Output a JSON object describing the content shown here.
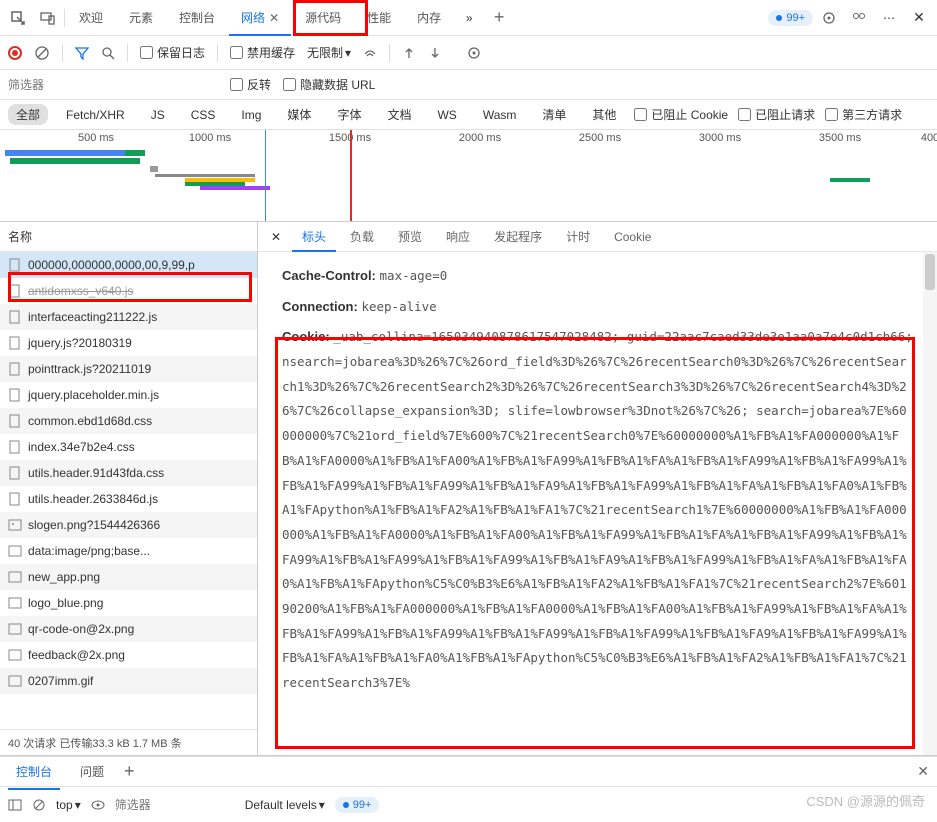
{
  "topTabs": {
    "welcome": "欢迎",
    "elements": "元素",
    "console": "控制台",
    "network": "网络",
    "sources": "源代码",
    "performance": "性能",
    "memory": "内存"
  },
  "badge99": "99+",
  "toolbar": {
    "preserve_log": "保留日志",
    "disable_cache": "禁用缓存",
    "throttling": "无限制"
  },
  "filter": {
    "placeholder": "筛选器",
    "invert": "反转",
    "hide_data_urls": "隐藏数据 URL"
  },
  "types": {
    "all": "全部",
    "fetch": "Fetch/XHR",
    "js": "JS",
    "css": "CSS",
    "img": "Img",
    "media": "媒体",
    "font": "字体",
    "doc": "文档",
    "ws": "WS",
    "wasm": "Wasm",
    "manifest": "清单",
    "other": "其他",
    "blocked_cookie": "已阻止 Cookie",
    "blocked_req": "已阻止请求",
    "third_party": "第三方请求"
  },
  "timeline": {
    "t500": "500 ms",
    "t1000": "1000 ms",
    "t1500": "1500 ms",
    "t2000": "2000 ms",
    "t2500": "2500 ms",
    "t3000": "3000 ms",
    "t3500": "3500 ms",
    "t4000": "400"
  },
  "leftHeader": "名称",
  "files": [
    "000000,000000,0000,00,9,99,p",
    "antidomxss_v640.js",
    "interfaceacting211222.js",
    "jquery.js?20180319",
    "pointtrack.js?20211019",
    "jquery.placeholder.min.js",
    "common.ebd1d68d.css",
    "index.34e7b2e4.css",
    "utils.header.91d43fda.css",
    "utils.header.2633846d.js",
    "slogen.png?1544426366",
    "data:image/png;base...",
    "new_app.png",
    "logo_blue.png",
    "qr-code-on@2x.png",
    "feedback@2x.png",
    "0207imm.gif"
  ],
  "statusBar": "40 次请求  已传输33.3 kB  1.7 MB 条",
  "detailTabs": {
    "headers": "标头",
    "payload": "负载",
    "preview": "预览",
    "response": "响应",
    "initiator": "发起程序",
    "timing": "计时",
    "cookies": "Cookie"
  },
  "headers": {
    "cache_k": "Cache-Control:",
    "cache_v": "max-age=0",
    "conn_k": "Connection:",
    "conn_v": "keep-alive",
    "cookie_k": "Cookie:",
    "cookie_v": "_uab_collina=165034940878617547028482; guid=22aac7caed33de3e1aa0a7e4c0d1cb66; nsearch=jobarea%3D%26%7C%26ord_field%3D%26%7C%26recentSearch0%3D%26%7C%26recentSearch1%3D%26%7C%26recentSearch2%3D%26%7C%26recentSearch3%3D%26%7C%26recentSearch4%3D%26%7C%26collapse_expansion%3D; slife=lowbrowser%3Dnot%26%7C%26; search=jobarea%7E%60000000%7C%21ord_field%7E%600%7C%21recentSearch0%7E%60000000%A1%FB%A1%FA000000%A1%FB%A1%FA0000%A1%FB%A1%FA00%A1%FB%A1%FA99%A1%FB%A1%FA%A1%FB%A1%FA99%A1%FB%A1%FA99%A1%FB%A1%FA99%A1%FB%A1%FA99%A1%FB%A1%FA9%A1%FB%A1%FA99%A1%FB%A1%FA%A1%FB%A1%FA0%A1%FB%A1%FApython%A1%FB%A1%FA2%A1%FB%A1%FA1%7C%21recentSearch1%7E%60000000%A1%FB%A1%FA000000%A1%FB%A1%FA0000%A1%FB%A1%FA00%A1%FB%A1%FA99%A1%FB%A1%FA%A1%FB%A1%FA99%A1%FB%A1%FA99%A1%FB%A1%FA99%A1%FB%A1%FA99%A1%FB%A1%FA9%A1%FB%A1%FA99%A1%FB%A1%FA%A1%FB%A1%FA0%A1%FB%A1%FApython%C5%C0%B3%E6%A1%FB%A1%FA2%A1%FB%A1%FA1%7C%21recentSearch2%7E%60190200%A1%FB%A1%FA000000%A1%FB%A1%FA0000%A1%FB%A1%FA00%A1%FB%A1%FA99%A1%FB%A1%FA%A1%FB%A1%FA99%A1%FB%A1%FA99%A1%FB%A1%FA99%A1%FB%A1%FA99%A1%FB%A1%FA9%A1%FB%A1%FA99%A1%FB%A1%FA%A1%FB%A1%FA0%A1%FB%A1%FApython%C5%C0%B3%E6%A1%FB%A1%FA2%A1%FB%A1%FA1%7C%21recentSearch3%7E%"
  },
  "drawer": {
    "console": "控制台",
    "issues": "问题"
  },
  "bottomBar": {
    "top": "top",
    "filter": "筛选器",
    "levels": "Default levels",
    "badge": "99+"
  },
  "watermark": "CSDN @源源的佩奇"
}
